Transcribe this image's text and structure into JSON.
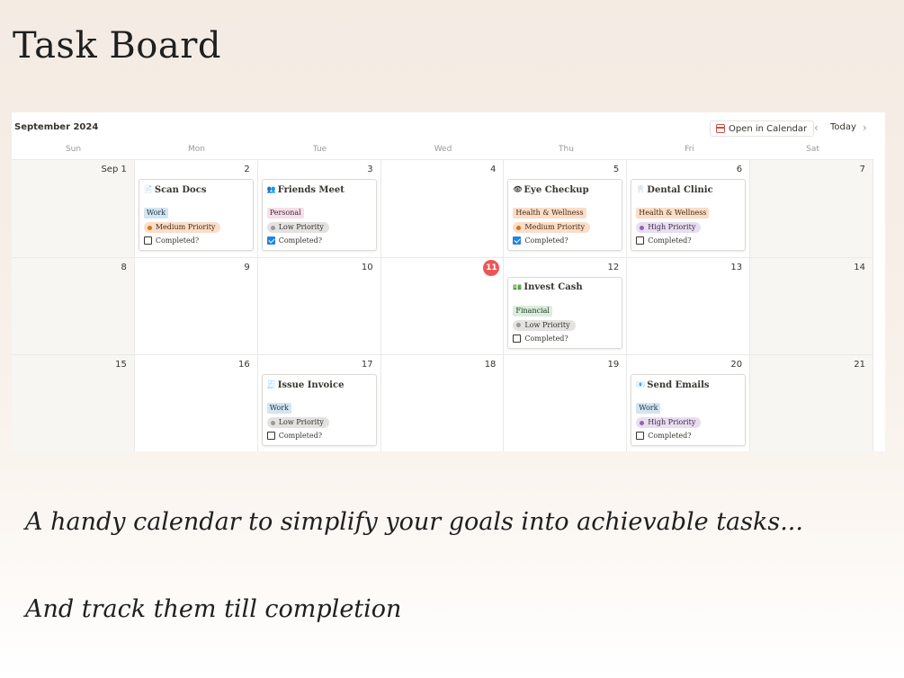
{
  "title": "Task Board",
  "calendar": {
    "month": "September 2024",
    "open_button": "Open in Calendar",
    "today_button": "Today",
    "prev_icon": "chevron-left-icon",
    "next_icon": "chevron-right-icon",
    "weekdays": [
      "Sun",
      "Mon",
      "Tue",
      "Wed",
      "Thu",
      "Fri",
      "Sat"
    ],
    "today_day": "11",
    "days": [
      {
        "n": "Sep 1",
        "weekend": true
      },
      {
        "n": "2",
        "task": {
          "title": "Scan Docs",
          "icon": "📄",
          "tag": "Work",
          "tag_style": "work",
          "priority": "Medium Priority",
          "priority_style": "medium",
          "completed_label": "Completed?",
          "completed": false
        }
      },
      {
        "n": "3",
        "task": {
          "title": "Friends Meet",
          "icon": "👥",
          "tag": "Personal",
          "tag_style": "personal",
          "priority": "Low Priority",
          "priority_style": "low",
          "completed_label": "Completed?",
          "completed": true
        }
      },
      {
        "n": "4"
      },
      {
        "n": "5",
        "task": {
          "title": "Eye Checkup",
          "icon": "👁",
          "tag": "Health & Wellness",
          "tag_style": "health",
          "priority": "Medium Priority",
          "priority_style": "medium",
          "completed_label": "Completed?",
          "completed": true
        }
      },
      {
        "n": "6",
        "task": {
          "title": "Dental Clinic",
          "icon": "🦷",
          "tag": "Health & Wellness",
          "tag_style": "health",
          "priority": "High Priority",
          "priority_style": "high",
          "completed_label": "Completed?",
          "completed": false
        }
      },
      {
        "n": "7",
        "weekend": true
      },
      {
        "n": "8",
        "weekend": true
      },
      {
        "n": "9"
      },
      {
        "n": "10"
      },
      {
        "n": "11",
        "today": true
      },
      {
        "n": "12",
        "task": {
          "title": "Invest Cash",
          "icon": "💵",
          "tag": "Financial",
          "tag_style": "financial",
          "priority": "Low Priority",
          "priority_style": "low",
          "completed_label": "Completed?",
          "completed": false
        }
      },
      {
        "n": "13"
      },
      {
        "n": "14",
        "weekend": true
      },
      {
        "n": "15",
        "weekend": true
      },
      {
        "n": "16"
      },
      {
        "n": "17",
        "task": {
          "title": "Issue Invoice",
          "icon": "🧾",
          "tag": "Work",
          "tag_style": "work",
          "priority": "Low Priority",
          "priority_style": "low",
          "completed_label": "Completed?",
          "completed": false
        }
      },
      {
        "n": "18"
      },
      {
        "n": "19"
      },
      {
        "n": "20",
        "task": {
          "title": "Send Emails",
          "icon": "📧",
          "tag": "Work",
          "tag_style": "work",
          "priority": "High Priority",
          "priority_style": "high",
          "completed_label": "Completed?",
          "completed": false
        }
      },
      {
        "n": "21",
        "weekend": true
      }
    ]
  },
  "taglines": [
    "A handy calendar to simplify your goals into achievable tasks...",
    "And track them till completion"
  ]
}
